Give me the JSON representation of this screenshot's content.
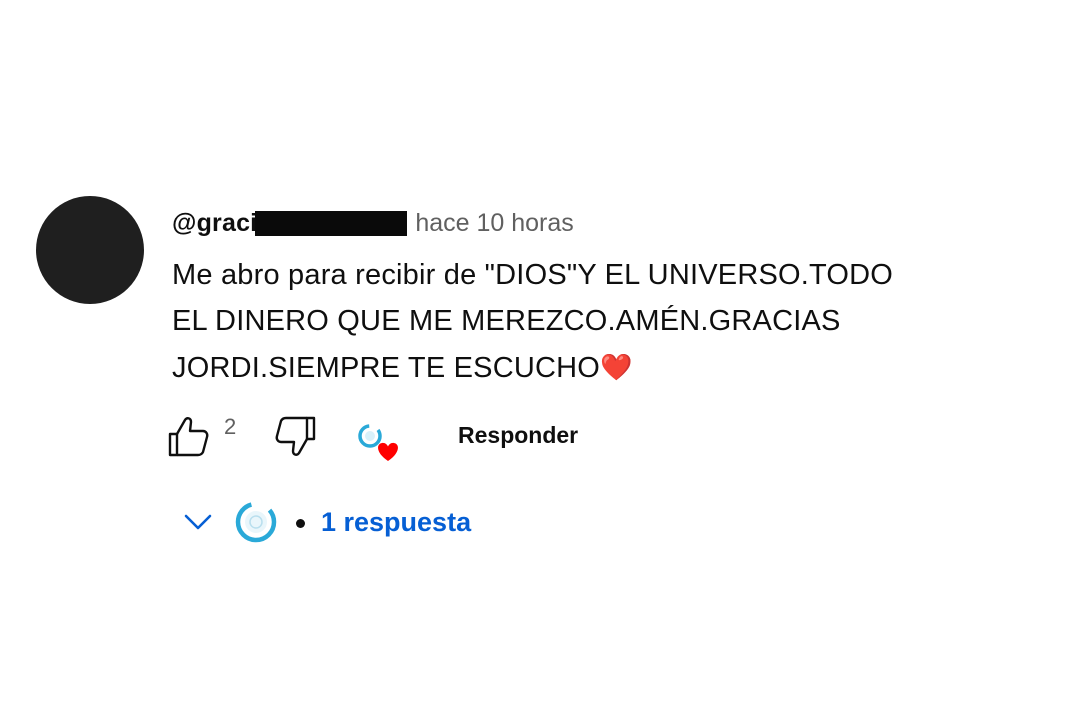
{
  "comment": {
    "handle": "@graci",
    "timestamp": "hace 10 horas",
    "text_lines": [
      "Me abro para recibir de \"DIOS\"Y EL UNIVERSO.TODO",
      "EL DINERO QUE ME MEREZCO.AMÉN.GRACIAS",
      "JORDI.SIEMPRE TE ESCUCHO"
    ],
    "emoji": "❤️",
    "like_count": "2",
    "reply_label": "Responder",
    "replies_label": "1 respuesta"
  },
  "colors": {
    "link_blue": "#065fd4",
    "heart_red": "#ff0000",
    "secondary_text": "#606060"
  },
  "icons": {
    "like": "thumbs-up-icon",
    "dislike": "thumbs-down-icon",
    "creator_heart": "creator-heart-icon",
    "expand": "chevron-down-icon"
  }
}
